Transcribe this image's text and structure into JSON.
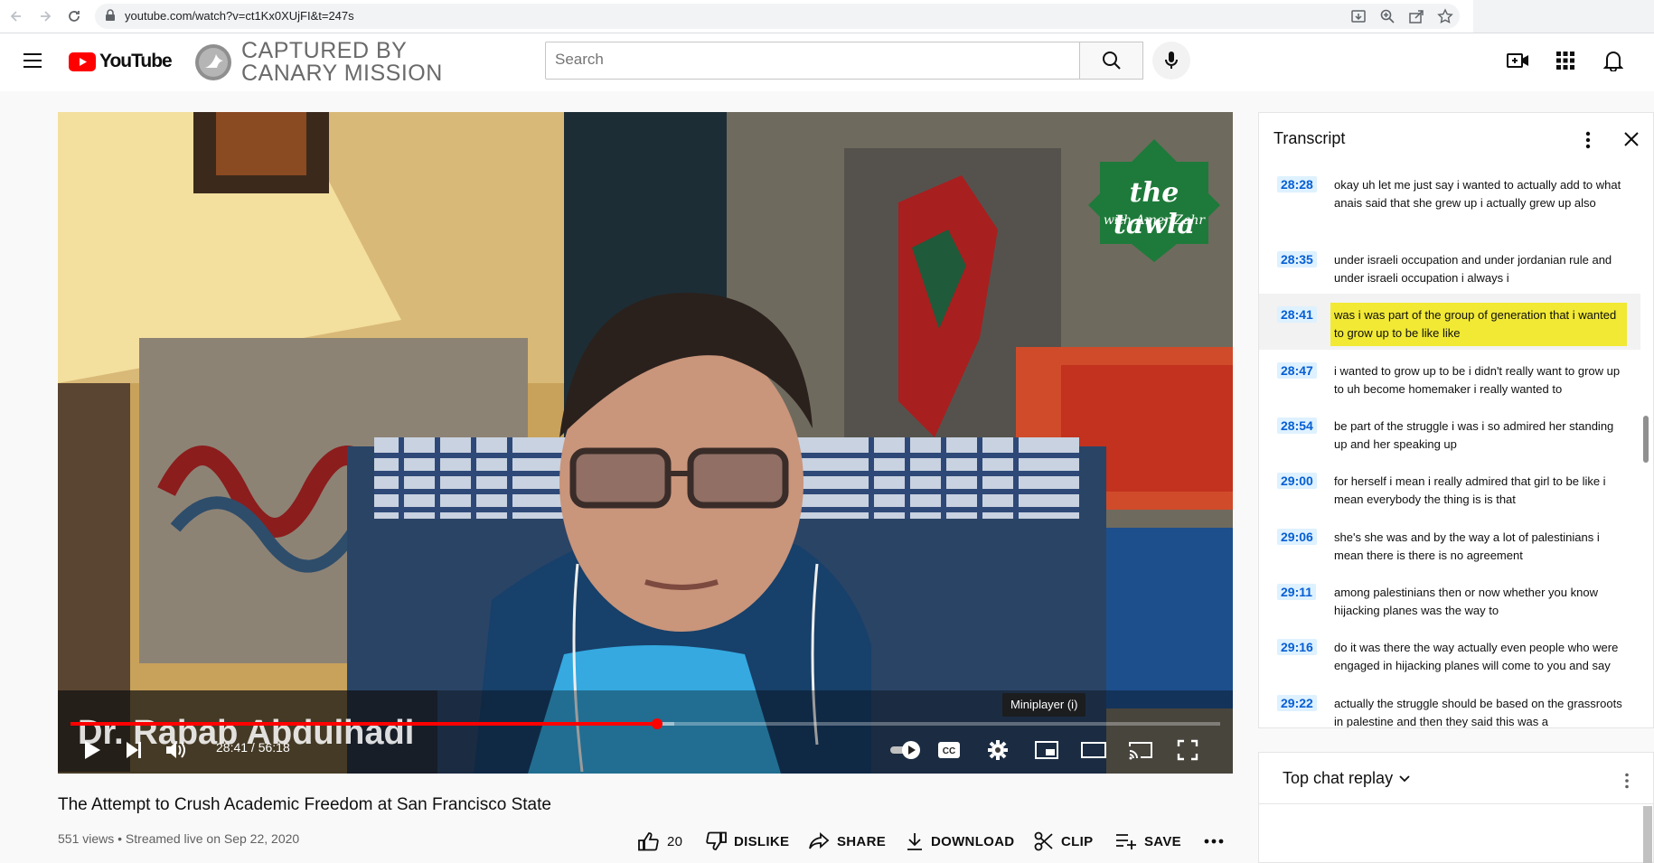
{
  "browser": {
    "url": "youtube.com/watch?v=ct1Kx0XUjFI&t=247s"
  },
  "header": {
    "logo_text": "YouTube",
    "channel_banner_line1": "CAPTURED BY",
    "channel_banner_line2": "CANARY MISSION",
    "search_placeholder": "Search"
  },
  "video": {
    "watermark_line1": "the tawla",
    "watermark_line2": "with Amer Zahr",
    "lower_third_name": "Dr. Rabab Abdulhadi",
    "tooltip": "Miniplayer (i)",
    "time_display": "28:41 / 56:18",
    "progress_fraction": 0.51,
    "buffer_fraction": 0.525,
    "accent_color": "#ff0000"
  },
  "details": {
    "title": "The Attempt to Crush Academic Freedom at San Francisco State",
    "meta": "551 views • Streamed live on Sep 22, 2020",
    "like_count": "20",
    "dislike_label": "DISLIKE",
    "share_label": "SHARE",
    "download_label": "DOWNLOAD",
    "clip_label": "CLIP",
    "save_label": "SAVE"
  },
  "transcript": {
    "title": "Transcript",
    "segments": [
      {
        "time": "28:28",
        "text": "okay uh let me just say i wanted to actually add to what anais said that she grew up i actually grew up also"
      },
      {
        "time": "28:35",
        "text": "under israeli occupation and under jordanian rule and under israeli occupation i always i"
      },
      {
        "time": "28:41",
        "text": "was i was part of the group of generation that i wanted to grow up to be like like",
        "active": true
      },
      {
        "time": "28:47",
        "text": "i wanted to grow up to be i didn't really want to grow up to uh become homemaker i really wanted to"
      },
      {
        "time": "28:54",
        "text": "be part of the struggle i was i so admired her standing up and her speaking up"
      },
      {
        "time": "29:00",
        "text": "for herself i mean i really admired that girl to be like i mean everybody the thing is is that"
      },
      {
        "time": "29:06",
        "text": "she's she was and by the way a lot of palestinians i mean there is there is no agreement"
      },
      {
        "time": "29:11",
        "text": "among palestinians then or now whether you know hijacking planes was the way to"
      },
      {
        "time": "29:16",
        "text": "do it was there the way actually even people who were engaged in hijacking planes will come to you and say"
      },
      {
        "time": "29:22",
        "text": "actually the struggle should be based on the grassroots in palestine and then they said this was a"
      }
    ]
  },
  "chat": {
    "title": "Top chat replay"
  }
}
